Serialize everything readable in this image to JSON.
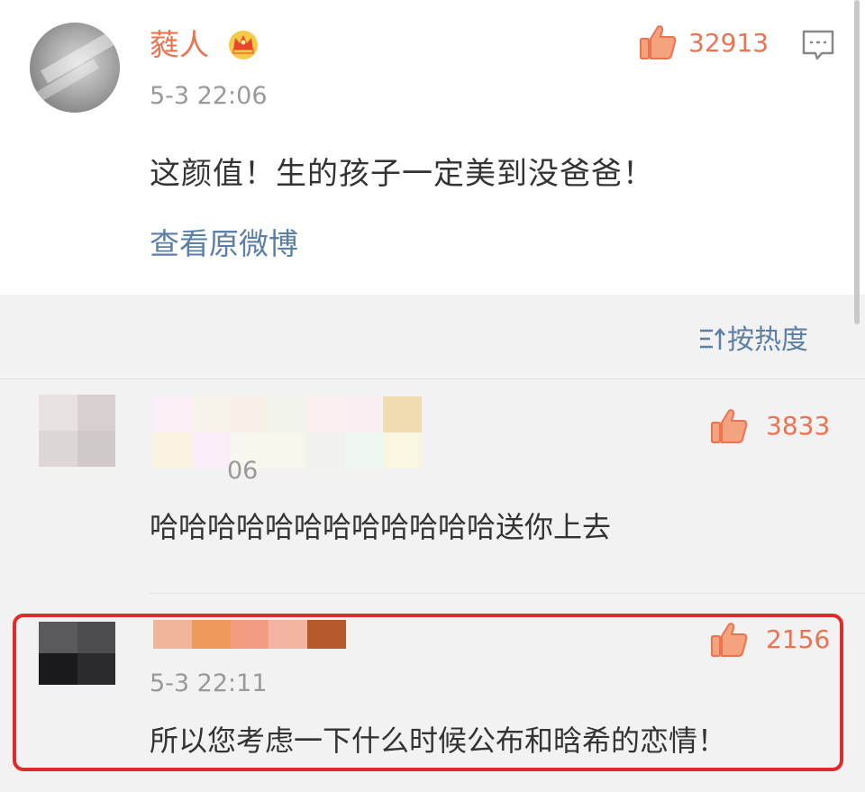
{
  "post": {
    "username": "蕤人",
    "like_count": "32913",
    "time": "5-3 22:06",
    "content": "这颜值！生的孩子一定美到没爸爸！",
    "view_original": "查看原微博",
    "icons": [
      "crown-badge-icon",
      "thumbs-up-icon",
      "comment-icon"
    ]
  },
  "sort": {
    "label": "按热度"
  },
  "comments": [
    {
      "like_count": "3833",
      "time_partial": "06",
      "content": "哈哈哈哈哈哈哈哈哈哈哈哈送你上去"
    },
    {
      "like_count": "2156",
      "time": "5-3 22:11",
      "content": "所以您考虑一下什么时候公布和晗希的恋情！"
    }
  ],
  "colors": {
    "accent": "#eb7350",
    "link": "#5b7fa6",
    "highlight": "#e12a2a",
    "text": "#333333",
    "meta": "#999999"
  }
}
